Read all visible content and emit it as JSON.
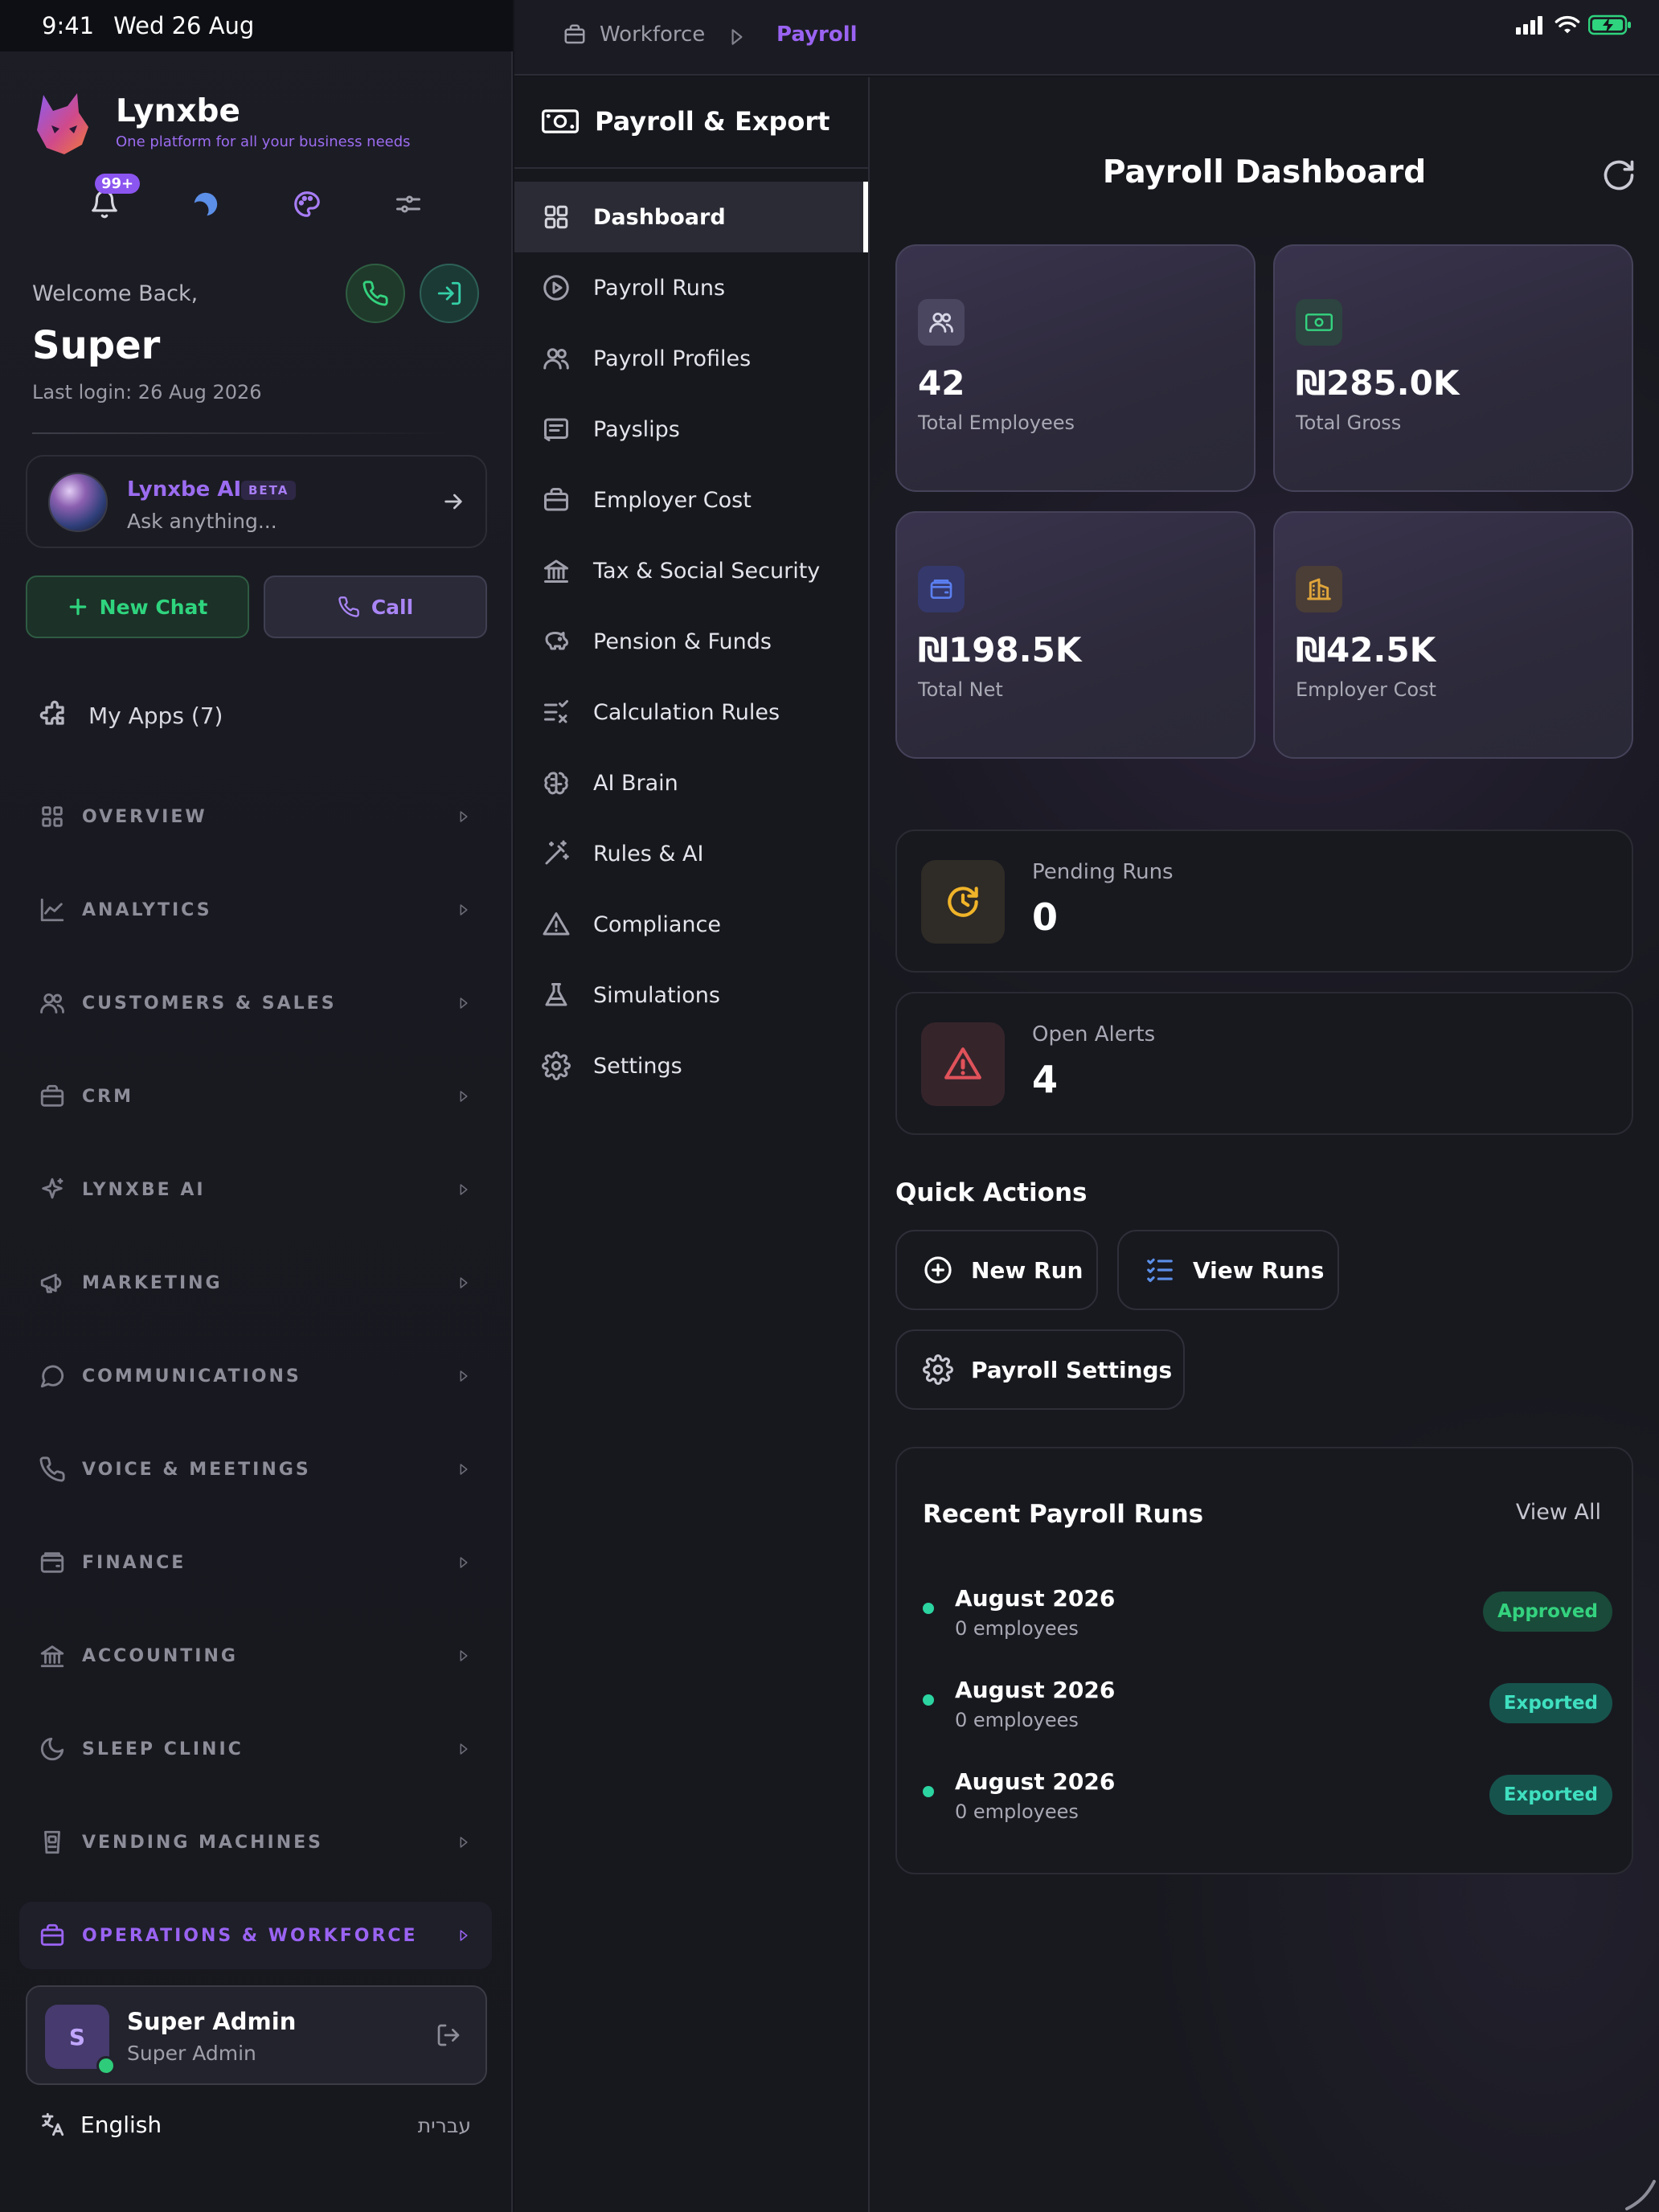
{
  "status": {
    "time": "9:41",
    "date": "Wed 26 Aug"
  },
  "brand": {
    "name": "Lynxbe",
    "tagline": "One platform for all your business needs"
  },
  "notifications": {
    "badge": "99+"
  },
  "user": {
    "welcome": "Welcome Back,",
    "name": "Super",
    "last_login": "Last login: 26 Aug 2026"
  },
  "ai": {
    "title": "Lynxbe AI",
    "badge": "BETA",
    "placeholder": "Ask anything..."
  },
  "actions": {
    "new_chat": "New Chat",
    "call": "Call"
  },
  "my_apps": "My Apps (7)",
  "sections": [
    {
      "label": "OVERVIEW",
      "icon": "grid-icon"
    },
    {
      "label": "ANALYTICS",
      "icon": "chart-icon"
    },
    {
      "label": "CUSTOMERS & SALES",
      "icon": "users-icon"
    },
    {
      "label": "CRM",
      "icon": "briefcase-icon"
    },
    {
      "label": "LYNXBE AI",
      "icon": "sparkle-icon"
    },
    {
      "label": "MARKETING",
      "icon": "megaphone-icon"
    },
    {
      "label": "COMMUNICATIONS",
      "icon": "chat-bubble-icon"
    },
    {
      "label": "VOICE & MEETINGS",
      "icon": "phone-icon"
    },
    {
      "label": "FINANCE",
      "icon": "wallet-icon"
    },
    {
      "label": "ACCOUNTING",
      "icon": "bank-icon"
    },
    {
      "label": "SLEEP CLINIC",
      "icon": "moon-icon"
    },
    {
      "label": "VENDING MACHINES",
      "icon": "vending-icon"
    },
    {
      "label": "OPERATIONS & WORKFORCE",
      "icon": "briefcase-icon"
    }
  ],
  "account": {
    "name": "Super Admin",
    "role": "Super Admin",
    "initial": "S"
  },
  "language": {
    "current": "English",
    "alternate": "עברית"
  },
  "breadcrumb": {
    "parent": "Workforce",
    "current": "Payroll"
  },
  "module": {
    "title": "Payroll & Export"
  },
  "nav": [
    {
      "label": "Dashboard",
      "icon": "dashboard-icon"
    },
    {
      "label": "Payroll Runs",
      "icon": "play-circle-icon"
    },
    {
      "label": "Payroll Profiles",
      "icon": "users-icon"
    },
    {
      "label": "Payslips",
      "icon": "receipt-icon"
    },
    {
      "label": "Employer Cost",
      "icon": "briefcase-icon"
    },
    {
      "label": "Tax & Social Security",
      "icon": "bank-icon"
    },
    {
      "label": "Pension & Funds",
      "icon": "piggy-bank-icon"
    },
    {
      "label": "Calculation Rules",
      "icon": "list-check-icon"
    },
    {
      "label": "AI Brain",
      "icon": "brain-icon"
    },
    {
      "label": "Rules & AI",
      "icon": "magic-wand-icon"
    },
    {
      "label": "Compliance",
      "icon": "warning-icon"
    },
    {
      "label": "Simulations",
      "icon": "flask-icon"
    },
    {
      "label": "Settings",
      "icon": "gear-icon"
    }
  ],
  "dashboard": {
    "title": "Payroll Dashboard",
    "stats": [
      {
        "value": "42",
        "label": "Total Employees",
        "icon": "users-icon"
      },
      {
        "value": "₪285.0K",
        "label": "Total Gross",
        "icon": "cash-icon"
      },
      {
        "value": "₪198.5K",
        "label": "Total Net",
        "icon": "wallet-icon"
      },
      {
        "value": "₪42.5K",
        "label": "Employer Cost",
        "icon": "building-icon"
      }
    ],
    "pending": {
      "label": "Pending Runs",
      "value": "0"
    },
    "alerts": {
      "label": "Open Alerts",
      "value": "4"
    },
    "quick_actions": {
      "title": "Quick Actions",
      "new_run": "New Run",
      "view_runs": "View Runs",
      "settings": "Payroll Settings"
    },
    "recent": {
      "title": "Recent Payroll Runs",
      "view_all": "View All",
      "rows": [
        {
          "name": "August 2026",
          "sub": "0 employees",
          "status": "Approved"
        },
        {
          "name": "August 2026",
          "sub": "0 employees",
          "status": "Exported"
        },
        {
          "name": "August 2026",
          "sub": "0 employees",
          "status": "Exported"
        }
      ]
    }
  },
  "colors": {
    "accent": "#9a63f2",
    "success": "#2fd47e",
    "teal": "#2bd4a0",
    "warning": "#f0b429",
    "danger": "#e0525a"
  }
}
